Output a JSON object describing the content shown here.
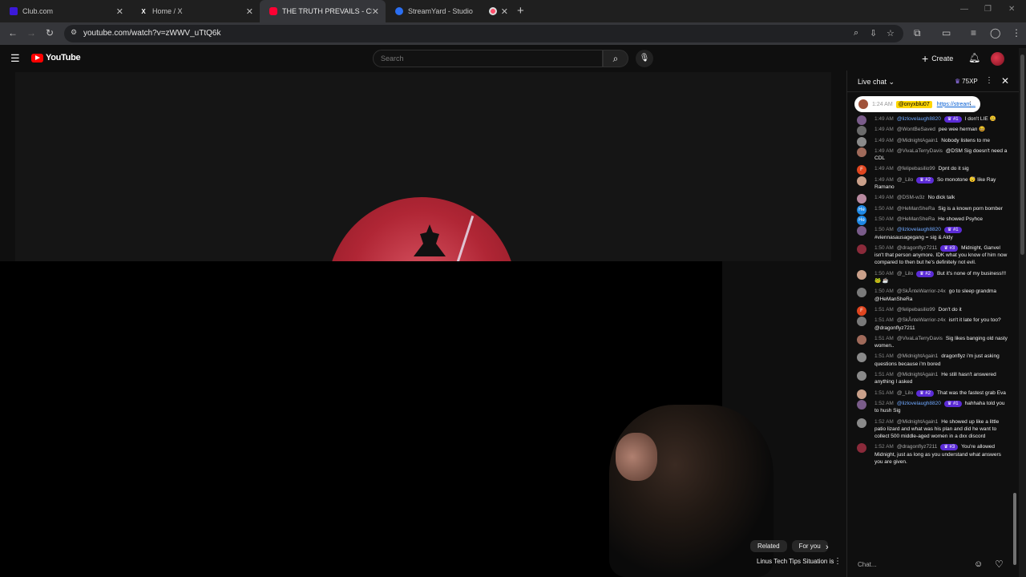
{
  "browser": {
    "tabs": [
      {
        "title": "Club.com",
        "favicon_color": "#3b19d9"
      },
      {
        "title": "Home / X",
        "favicon_glyph": "X"
      },
      {
        "title": "THE TRUTH PREVAILS - CRYSTA",
        "favicon_color": "#ff0033",
        "active": true
      },
      {
        "title": "StreamYard - Studio",
        "favicon_color": "#2b6ff2"
      },
      {
        "title": "",
        "favicon_color": "#ff4e6a"
      }
    ],
    "url": "youtube.com/watch?v=zWWV_uTtQ6k"
  },
  "youtube": {
    "logo_text": "YouTube",
    "search_placeholder": "Search",
    "create_label": "Create"
  },
  "video": {
    "chips": [
      "Related",
      "For you"
    ],
    "recommendation_title": "Linus Tech Tips Situation is"
  },
  "live_chat": {
    "title": "Live chat",
    "xp": "75XP",
    "pinned": {
      "time": "1:24 AM",
      "user": "@onyxblu07",
      "link": "https://stream..."
    },
    "input_placeholder": "Chat...",
    "messages": [
      {
        "time": "1:49 AM",
        "user": "@lizlovelaugh8820",
        "verified": true,
        "badge": "#1",
        "text": "I don't LIE 🤐",
        "avatar_color": "#7a5c8a"
      },
      {
        "time": "1:49 AM",
        "user": "@WontBeSaved",
        "text": "pee wee herman 😆",
        "avatar_color": "#6b6b6b"
      },
      {
        "time": "1:49 AM",
        "user": "@MidnightAgain1",
        "text": "Nobody listens to me",
        "avatar_color": "#8a8a8a"
      },
      {
        "time": "1:49 AM",
        "user": "@VivaLaTerryDavis",
        "text": "@DSM Sig doesn't need a CDL",
        "avatar_color": "#a06a5a"
      },
      {
        "time": "1:49 AM",
        "user": "@felipebasilio99",
        "text": "Dpnt do it sig",
        "avatar_color": "#e0451f",
        "avatar_letter": "F"
      },
      {
        "time": "1:49 AM",
        "user": "@_Lilo",
        "badge": "#2",
        "text": "So monotone 😴 like Ray Ramano",
        "avatar_color": "#caa08a"
      },
      {
        "time": "1:49 AM",
        "user": "@DSM-w3z",
        "text": "No dick talk",
        "avatar_color": "#b88aa0"
      },
      {
        "time": "1:50 AM",
        "user": "@HeManSheRa",
        "text": "Sig is a known porn bomber",
        "avatar_color": "#1e88e5",
        "avatar_letter": "He"
      },
      {
        "time": "1:50 AM",
        "user": "@HeManSheRa",
        "text": "He showed Psyhce",
        "avatar_color": "#1e88e5",
        "avatar_letter": "He"
      },
      {
        "time": "1:50 AM",
        "user": "@lizlovelaugh8820",
        "verified": true,
        "badge": "#1",
        "text": "#viennasausagegang = sig & Aldy",
        "avatar_color": "#7a5c8a"
      },
      {
        "time": "1:50 AM",
        "user": "@dragonflyz7211",
        "badge": "#3",
        "text": "Midnight, Ganvel isn't that person anymore. IDK what you know of him now compared to then but he's definitely not evil.",
        "avatar_color": "#8a2a3a"
      },
      {
        "time": "1:50 AM",
        "user": "@_Lilo",
        "badge": "#2",
        "text": "But it's none of my business!!! 🐸 ☕",
        "avatar_color": "#caa08a"
      },
      {
        "time": "1:50 AM",
        "user": "@SkÅnteWarrior-z4x",
        "text": "go to sleep grandma @HeManSheRa",
        "avatar_color": "#7a7a7a"
      },
      {
        "time": "1:51 AM",
        "user": "@felipebasilio99",
        "text": "Don't do it",
        "avatar_color": "#e0451f",
        "avatar_letter": "F"
      },
      {
        "time": "1:51 AM",
        "user": "@SkÅnteWarrior-z4x",
        "text": "isn't it late for you too? @dragonflyz7211",
        "avatar_color": "#7a7a7a"
      },
      {
        "time": "1:51 AM",
        "user": "@VivaLaTerryDavis",
        "text": "Sig likes banging old nasty women..",
        "avatar_color": "#a06a5a"
      },
      {
        "time": "1:51 AM",
        "user": "@MidnightAgain1",
        "text": "dragonflyz i'm just asking questions because i'm bored",
        "avatar_color": "#8a8a8a"
      },
      {
        "time": "1:51 AM",
        "user": "@MidnightAgain1",
        "text": "He still hasn't answered anything I asked",
        "avatar_color": "#8a8a8a"
      },
      {
        "time": "1:51 AM",
        "user": "@_Lilo",
        "badge": "#2",
        "text": "That was the fastest grab Eva",
        "avatar_color": "#caa08a"
      },
      {
        "time": "1:52 AM",
        "user": "@lizlovelaugh8820",
        "verified": true,
        "badge": "#1",
        "text": "hahhaha told you to hush Sig",
        "avatar_color": "#7a5c8a"
      },
      {
        "time": "1:52 AM",
        "user": "@MidnightAgain1",
        "text": "He showed up like a little patio lizard and what was his plan and did he want to collect 500 middle-aged women in a dxx discord",
        "avatar_color": "#8a8a8a"
      },
      {
        "time": "1:52 AM",
        "user": "@dragonflyz7211",
        "badge": "#3",
        "text": "You're allowed Midnight, just as long as you understand what answers you are given.",
        "avatar_color": "#8a2a3a"
      }
    ]
  }
}
